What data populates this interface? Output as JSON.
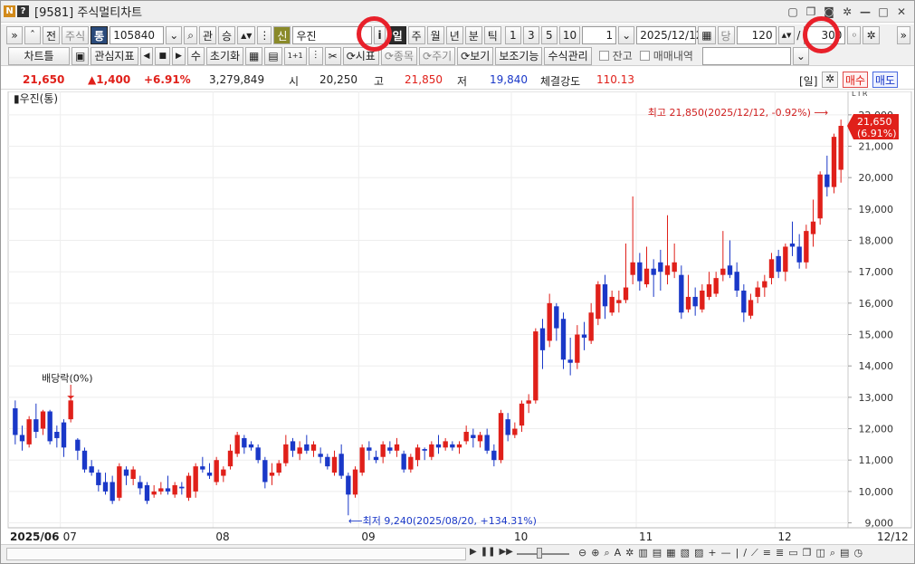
{
  "window": {
    "code": "[9581]",
    "title": "주식멀티차트"
  },
  "toolbar1": {
    "stock_code": "105840",
    "stock_name": "우진",
    "credit_badge": "신",
    "tong_label": "통",
    "jusik_label": "주식",
    "jeon_label": "전",
    "gwan_label": "관",
    "seung_label": "승",
    "periods": [
      "일",
      "주",
      "월",
      "년",
      "분",
      "틱"
    ],
    "selected_period": "일",
    "minutes": [
      "1",
      "3",
      "5",
      "10"
    ],
    "interval": "1",
    "date": "2025/12/12",
    "dang_label": "당",
    "count1": "120",
    "slash": "/",
    "count2": "300"
  },
  "toolbar2": {
    "buttons": [
      "차트틀",
      "관심지표",
      "수",
      "초기화",
      "시표",
      "종목",
      "주기",
      "보기",
      "보조기능",
      "수식관리"
    ],
    "checkbox1": "잔고",
    "checkbox2": "매매내역"
  },
  "quote": {
    "price": "21,650",
    "change": "▲1,400",
    "rate": "+6.91%",
    "volume": "3,279,849",
    "open_label": "시",
    "open": "20,250",
    "high_label": "고",
    "high": "21,850",
    "low_label": "저",
    "low": "19,840",
    "strength_label": "체결강도",
    "strength": "110.13",
    "period_tag": "[일]",
    "buy": "매수",
    "sell": "매도"
  },
  "chart_data": {
    "type": "candlestick",
    "title": "우진(통)",
    "scale_tag": "L I R",
    "y_ticks": [
      "22,000",
      "21,000",
      "20,000",
      "19,000",
      "18,000",
      "17,000",
      "16,000",
      "15,000",
      "14,000",
      "13,000",
      "12,000",
      "11,000",
      "10,000",
      "9,000"
    ],
    "ylim": [
      8900,
      22400
    ],
    "x_labels": [
      {
        "i": 1,
        "t": "2025/06"
      },
      {
        "i": 7,
        "t": "07"
      },
      {
        "i": 29,
        "t": "08"
      },
      {
        "i": 50,
        "t": "09"
      },
      {
        "i": 72,
        "t": "10"
      },
      {
        "i": 90,
        "t": "11"
      },
      {
        "i": 110,
        "t": "12"
      },
      {
        "i": 121,
        "t": "12/12"
      }
    ],
    "current_price": "21,650",
    "current_rate": "(6.91%)",
    "max_annotation": "최고 21,850(2025/12/12, -0.92%)",
    "min_annotation": "최저 9,240(2025/08/20, +134.31%)",
    "event_annotation": "배당락(0%)",
    "candles": [
      [
        12650,
        12900,
        11500,
        11800
      ],
      [
        11800,
        12100,
        11300,
        11600
      ],
      [
        11500,
        12400,
        11400,
        12300
      ],
      [
        12300,
        12800,
        11700,
        11900
      ],
      [
        12000,
        12600,
        11800,
        12550
      ],
      [
        12550,
        12600,
        11500,
        11600
      ],
      [
        11900,
        12100,
        11400,
        11700
      ],
      [
        12200,
        12300,
        11100,
        11400
      ],
      [
        12300,
        13000,
        12200,
        12900
      ],
      [
        11650,
        11700,
        11000,
        11300
      ],
      [
        11300,
        11400,
        10600,
        10700
      ],
      [
        10800,
        11000,
        10500,
        10600
      ],
      [
        10600,
        10700,
        10000,
        10200
      ],
      [
        10300,
        10600,
        9900,
        10000
      ],
      [
        10300,
        10500,
        9600,
        9700
      ],
      [
        9800,
        10900,
        9700,
        10800
      ],
      [
        10700,
        10800,
        10200,
        10500
      ],
      [
        10400,
        10800,
        10200,
        10700
      ],
      [
        10300,
        10500,
        9900,
        10100
      ],
      [
        10200,
        10300,
        9600,
        9700
      ],
      [
        9900,
        10200,
        9800,
        10000
      ],
      [
        10000,
        10300,
        9900,
        10100
      ],
      [
        10100,
        10500,
        9900,
        10000
      ],
      [
        9900,
        10300,
        9800,
        10200
      ],
      [
        10150,
        10300,
        9900,
        10100
      ],
      [
        9800,
        10600,
        9700,
        10500
      ],
      [
        10000,
        10900,
        9800,
        10800
      ],
      [
        10800,
        11100,
        10600,
        10700
      ],
      [
        10600,
        10900,
        10400,
        10500
      ],
      [
        10300,
        11100,
        10200,
        11000
      ],
      [
        10500,
        10800,
        10300,
        10700
      ],
      [
        10800,
        11500,
        10700,
        11300
      ],
      [
        11200,
        11900,
        11100,
        11800
      ],
      [
        11700,
        11800,
        11200,
        11400
      ],
      [
        11500,
        11600,
        11300,
        11400
      ],
      [
        11400,
        11500,
        10900,
        11000
      ],
      [
        11000,
        11100,
        10100,
        10300
      ],
      [
        10500,
        10900,
        10200,
        10600
      ],
      [
        10600,
        11000,
        10500,
        10900
      ],
      [
        10900,
        11800,
        10800,
        11500
      ],
      [
        11600,
        11700,
        11100,
        11300
      ],
      [
        11200,
        11600,
        11000,
        11400
      ],
      [
        11500,
        11800,
        11200,
        11300
      ],
      [
        11300,
        11600,
        11100,
        11500
      ],
      [
        11200,
        11400,
        10900,
        11100
      ],
      [
        11100,
        11200,
        10700,
        10800
      ],
      [
        10600,
        11300,
        10500,
        11100
      ],
      [
        11200,
        11500,
        10400,
        10500
      ],
      [
        10500,
        10600,
        9240,
        9900
      ],
      [
        9900,
        10800,
        9800,
        10700
      ],
      [
        10600,
        11500,
        10500,
        11400
      ],
      [
        11400,
        11600,
        11000,
        11300
      ],
      [
        11100,
        11300,
        10900,
        11000
      ],
      [
        11100,
        11600,
        10900,
        11500
      ],
      [
        11400,
        11600,
        11200,
        11300
      ],
      [
        11300,
        11700,
        11100,
        11500
      ],
      [
        11200,
        11300,
        10600,
        10700
      ],
      [
        10700,
        11200,
        10600,
        11100
      ],
      [
        11000,
        11500,
        10800,
        11400
      ],
      [
        11350,
        11400,
        11000,
        11300
      ],
      [
        11100,
        11600,
        11000,
        11500
      ],
      [
        11500,
        11800,
        11200,
        11400
      ],
      [
        11400,
        11700,
        11300,
        11600
      ],
      [
        11500,
        11600,
        11300,
        11400
      ],
      [
        11400,
        11600,
        11200,
        11500
      ],
      [
        11600,
        12100,
        11500,
        11900
      ],
      [
        11800,
        12000,
        11400,
        11700
      ],
      [
        11600,
        11900,
        11400,
        11800
      ],
      [
        11800,
        12000,
        11200,
        11300
      ],
      [
        11300,
        11500,
        10800,
        11000
      ],
      [
        11000,
        12600,
        10900,
        12500
      ],
      [
        12300,
        12500,
        11600,
        11800
      ],
      [
        11800,
        12200,
        11700,
        12000
      ],
      [
        12100,
        12900,
        11900,
        12800
      ],
      [
        12800,
        13100,
        12500,
        12900
      ],
      [
        12900,
        15200,
        12800,
        15100
      ],
      [
        15200,
        15500,
        13900,
        14500
      ],
      [
        14800,
        16300,
        14600,
        16000
      ],
      [
        15900,
        16000,
        14800,
        15200
      ],
      [
        15500,
        15700,
        13900,
        14200
      ],
      [
        14200,
        14900,
        13700,
        14100
      ],
      [
        14100,
        15300,
        13900,
        15000
      ],
      [
        15000,
        15400,
        14500,
        14900
      ],
      [
        14800,
        16000,
        14700,
        15700
      ],
      [
        15500,
        16700,
        15300,
        16600
      ],
      [
        16600,
        16900,
        15500,
        15900
      ],
      [
        15700,
        16400,
        15600,
        16200
      ],
      [
        16000,
        16400,
        15700,
        16100
      ],
      [
        16100,
        17900,
        16000,
        16500
      ],
      [
        16900,
        19400,
        16600,
        17300
      ],
      [
        17300,
        17600,
        16400,
        16700
      ],
      [
        16600,
        17800,
        16500,
        17100
      ],
      [
        17100,
        17400,
        16200,
        16900
      ],
      [
        17300,
        17700,
        16400,
        17000
      ],
      [
        16900,
        18800,
        16600,
        17200
      ],
      [
        17000,
        17900,
        16800,
        17300
      ],
      [
        16900,
        17200,
        15500,
        15700
      ],
      [
        15800,
        16900,
        15700,
        16200
      ],
      [
        16200,
        16500,
        15600,
        15900
      ],
      [
        15800,
        16600,
        15700,
        16400
      ],
      [
        16200,
        17000,
        16100,
        16600
      ],
      [
        16300,
        17000,
        16200,
        16800
      ],
      [
        16900,
        18300,
        16700,
        17100
      ],
      [
        17200,
        18000,
        16800,
        16900
      ],
      [
        17000,
        17300,
        16200,
        16400
      ],
      [
        16400,
        16600,
        15400,
        15700
      ],
      [
        15600,
        16300,
        15500,
        16100
      ],
      [
        16200,
        16700,
        16000,
        16500
      ],
      [
        16500,
        16900,
        16200,
        16700
      ],
      [
        16800,
        17600,
        16600,
        17400
      ],
      [
        17500,
        17700,
        16800,
        17000
      ],
      [
        17000,
        17900,
        16700,
        17800
      ],
      [
        17900,
        18600,
        17500,
        17800
      ],
      [
        17800,
        18200,
        17100,
        17300
      ],
      [
        17300,
        18500,
        17100,
        18300
      ],
      [
        18200,
        19300,
        17800,
        18600
      ],
      [
        18700,
        20200,
        18500,
        20100
      ],
      [
        20100,
        20700,
        19400,
        19700
      ],
      [
        19700,
        21400,
        19500,
        21300
      ],
      [
        20250,
        21850,
        19840,
        21650
      ]
    ]
  },
  "bottombar": {
    "date_right": "12/12"
  }
}
